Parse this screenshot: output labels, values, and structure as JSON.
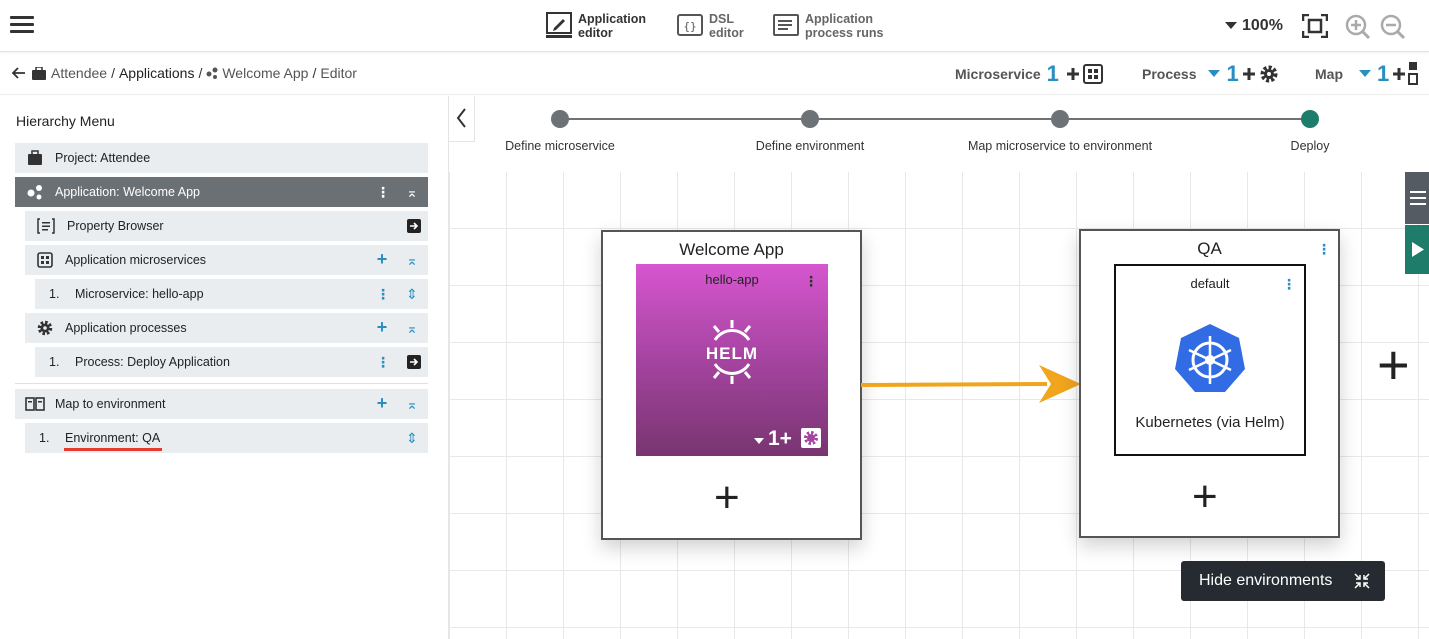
{
  "topbar": {
    "modes": [
      {
        "label1": "Application",
        "label2": "editor",
        "icon": "pencil-editor-icon",
        "active": true
      },
      {
        "label1": "DSL",
        "label2": "editor",
        "icon": "code-braces-icon",
        "active": false
      },
      {
        "label1": "Application",
        "label2": "process runs",
        "icon": "list-doc-icon",
        "active": false
      }
    ],
    "zoom": "100%"
  },
  "breadcrumb": {
    "project": "Attendee",
    "applications": "Applications",
    "app": "Welcome App",
    "page": "Editor"
  },
  "counters": [
    {
      "label": "Microservice",
      "count": "1"
    },
    {
      "label": "Process",
      "count": "1"
    },
    {
      "label": "Map",
      "count": "1"
    }
  ],
  "sidebar": {
    "title": "Hierarchy Menu",
    "items": [
      {
        "label": "Project: Attendee"
      },
      {
        "label": "Application: Welcome App"
      },
      {
        "label": "Property Browser"
      },
      {
        "label": "Application microservices"
      },
      {
        "num": "1.",
        "label": "Microservice: hello-app"
      },
      {
        "label": "Application processes"
      },
      {
        "num": "1.",
        "label": "Process: Deploy Application"
      },
      {
        "label": "Map to environment"
      },
      {
        "num": "1.",
        "label": "Environment: QA"
      }
    ]
  },
  "stepper": {
    "steps": [
      "Define microservice",
      "Define environment",
      "Map microservice to environment",
      "Deploy"
    ],
    "active_index": 3
  },
  "canvas": {
    "app_node": {
      "title": "Welcome App",
      "card_title": "hello-app",
      "card_logo": "HELM",
      "card_count": "1+"
    },
    "env_node": {
      "title": "QA",
      "inner_title": "default",
      "platform": "Kubernetes (via Helm)"
    },
    "hide_button": "Hide environments"
  },
  "colors": {
    "accent": "#2a8ec2",
    "active_step": "#1e7c6a",
    "arrow": "#f0a51d",
    "selected_row": "#6b7075"
  }
}
